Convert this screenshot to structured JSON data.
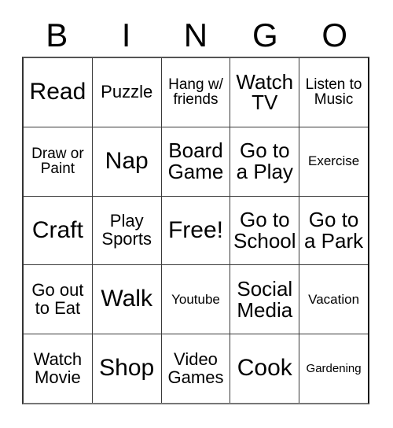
{
  "card": {
    "title_letters": [
      "B",
      "I",
      "N",
      "G",
      "O"
    ],
    "free_space_label": "Free!",
    "rows": [
      [
        {
          "text": "Read",
          "size": "xl"
        },
        {
          "text": "Puzzle",
          "size": "md"
        },
        {
          "text": "Hang w/ friends",
          "size": "sm"
        },
        {
          "text": "Watch TV",
          "size": "lg"
        },
        {
          "text": "Listen to Music",
          "size": "sm"
        }
      ],
      [
        {
          "text": "Draw or Paint",
          "size": "sm"
        },
        {
          "text": "Nap",
          "size": "xl"
        },
        {
          "text": "Board Game",
          "size": "lg"
        },
        {
          "text": "Go to a Play",
          "size": "lg"
        },
        {
          "text": "Exercise",
          "size": "xs"
        }
      ],
      [
        {
          "text": "Craft",
          "size": "xl"
        },
        {
          "text": "Play Sports",
          "size": "md"
        },
        {
          "text": "Free!",
          "size": "xl"
        },
        {
          "text": "Go to School",
          "size": "lg"
        },
        {
          "text": "Go to a Park",
          "size": "lg"
        }
      ],
      [
        {
          "text": "Go out to Eat",
          "size": "md"
        },
        {
          "text": "Walk",
          "size": "xl"
        },
        {
          "text": "Youtube",
          "size": "xs"
        },
        {
          "text": "Social Media",
          "size": "lg"
        },
        {
          "text": "Vacation",
          "size": "xs"
        }
      ],
      [
        {
          "text": "Watch Movie",
          "size": "md"
        },
        {
          "text": "Shop",
          "size": "xl"
        },
        {
          "text": "Video Games",
          "size": "md"
        },
        {
          "text": "Cook",
          "size": "xl"
        },
        {
          "text": "Gardening",
          "size": "xxs"
        }
      ]
    ]
  },
  "colors": {
    "background": "#ffffff",
    "text": "#000000",
    "grid_line": "#3a3a3a",
    "border": "#222222"
  }
}
